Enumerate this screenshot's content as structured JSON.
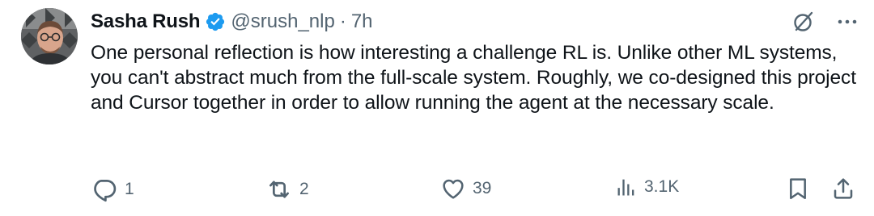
{
  "author": {
    "name": "Sasha Rush",
    "handle": "@srush_nlp",
    "separator": "·",
    "time": "7h"
  },
  "tweet": {
    "text": "One personal reflection is how interesting a challenge RL is. Unlike other ML systems, you can't abstract much from the full-scale system. Roughly, we co-designed this project and Cursor together in order to allow running the agent at the necessary scale."
  },
  "actions": {
    "replies": "1",
    "reposts": "2",
    "likes": "39",
    "views": "3.1K"
  },
  "icons": {
    "verified": "verified-badge-icon",
    "grok": "grok-icon",
    "more": "more-icon",
    "reply": "reply-icon",
    "repost": "repost-icon",
    "like": "heart-icon",
    "views": "views-icon",
    "bookmark": "bookmark-icon",
    "share": "share-icon"
  },
  "colors": {
    "verified": "#1d9bf0",
    "text": "#0f1419",
    "secondary": "#536471"
  }
}
